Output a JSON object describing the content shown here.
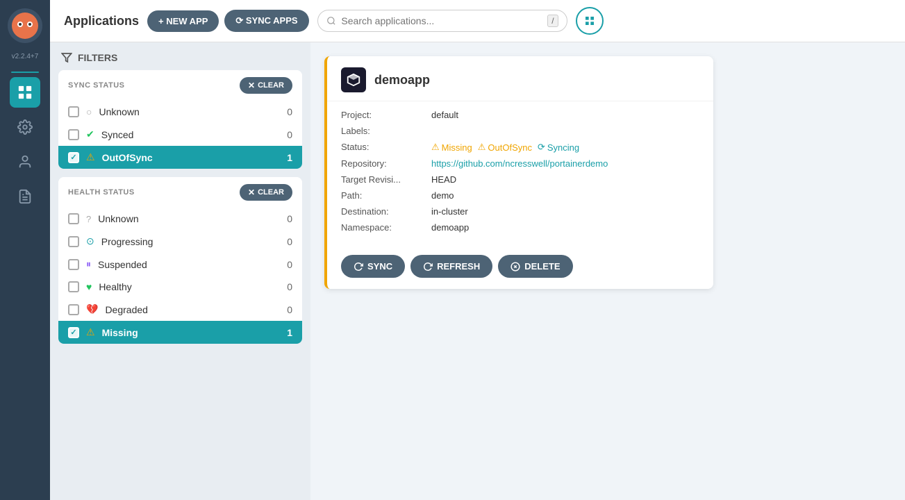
{
  "app": {
    "version": "v2.2.4+7",
    "header": {
      "title": "Applications",
      "new_app_label": "+ NEW APP",
      "sync_apps_label": "⟳ SYNC APPS",
      "search_placeholder": "Search applications...",
      "kbd_hint": "/"
    },
    "sidebar": {
      "items": [
        {
          "id": "apps",
          "label": "Applications",
          "icon": "layers"
        },
        {
          "id": "settings",
          "label": "Settings",
          "icon": "gear"
        },
        {
          "id": "user",
          "label": "User",
          "icon": "user"
        },
        {
          "id": "docs",
          "label": "Documentation",
          "icon": "doc"
        }
      ]
    },
    "filters": {
      "title": "FILTERS",
      "sync_status": {
        "title": "SYNC STATUS",
        "clear_label": "CLEAR",
        "items": [
          {
            "label": "Unknown",
            "count": 0,
            "selected": false,
            "icon": "❓",
            "icon_color": "#aaa"
          },
          {
            "label": "Synced",
            "count": 0,
            "selected": false,
            "icon": "✅",
            "icon_color": "#22c55e"
          },
          {
            "label": "OutOfSync",
            "count": 1,
            "selected": true,
            "icon": "⚠",
            "icon_color": "#f0a500"
          }
        ]
      },
      "health_status": {
        "title": "HEALTH STATUS",
        "clear_label": "CLEAR",
        "items": [
          {
            "label": "Unknown",
            "count": 0,
            "selected": false,
            "icon": "❓",
            "icon_color": "#aaa"
          },
          {
            "label": "Progressing",
            "count": 0,
            "selected": false,
            "icon": "○",
            "icon_color": "#1a9fa8"
          },
          {
            "label": "Suspended",
            "count": 0,
            "selected": false,
            "icon": "⏸",
            "icon_color": "#8b5cf6"
          },
          {
            "label": "Healthy",
            "count": 0,
            "selected": false,
            "icon": "💚",
            "icon_color": "#22c55e"
          },
          {
            "label": "Degraded",
            "count": 0,
            "selected": false,
            "icon": "💔",
            "icon_color": "#ef4444"
          },
          {
            "label": "Missing",
            "count": 1,
            "selected": true,
            "icon": "⚠",
            "icon_color": "#f0a500"
          }
        ]
      }
    },
    "app_card": {
      "name": "demoapp",
      "project": "default",
      "labels": "",
      "status": {
        "missing_label": "Missing",
        "outofsync_label": "OutOfSync",
        "syncing_label": "Syncing"
      },
      "repository": "https://github.com/ncresswell/portainerdemo",
      "target_revision_label": "Target Revisi...",
      "target_revision": "HEAD",
      "path_label": "Path:",
      "path": "demo",
      "destination_label": "Destination:",
      "destination": "in-cluster",
      "namespace_label": "Namespace:",
      "namespace": "demoapp",
      "actions": {
        "sync_label": "SYNC",
        "refresh_label": "REFRESH",
        "delete_label": "DELETE"
      }
    }
  }
}
